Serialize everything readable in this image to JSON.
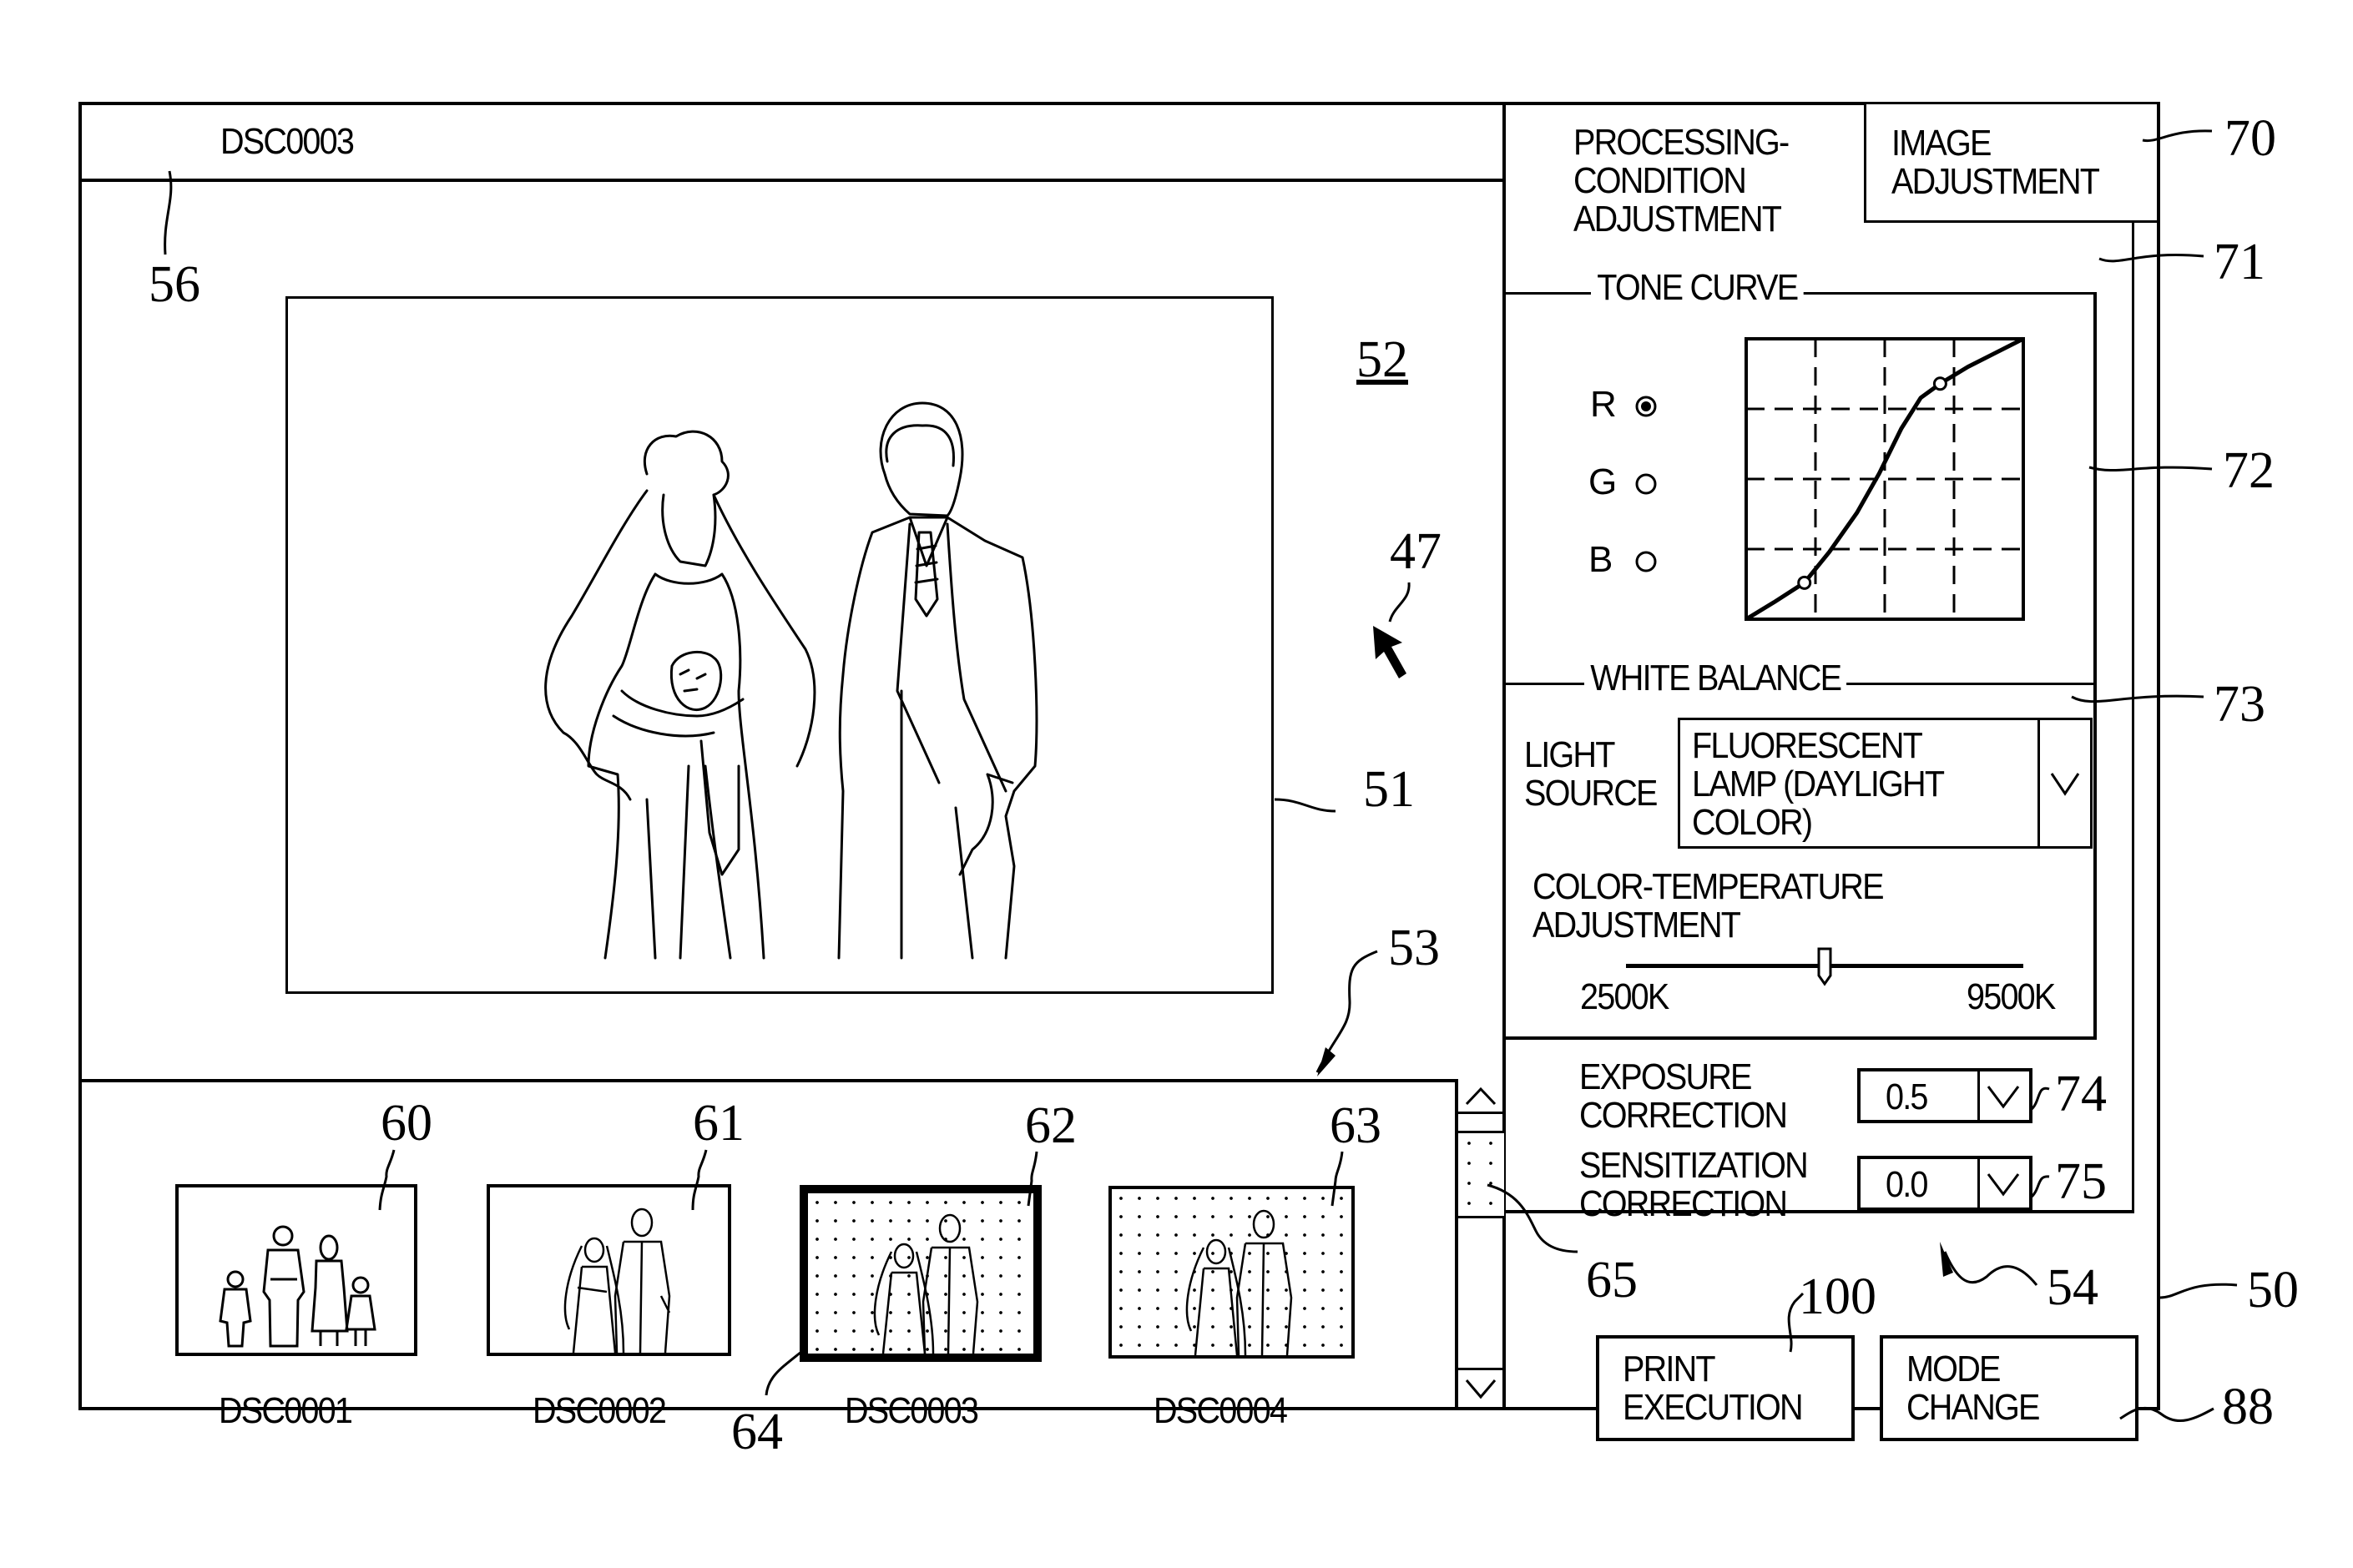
{
  "window": {
    "title": "DSC0003"
  },
  "preview": {
    "image_name": "DSC0003",
    "image_description": "bride and groom line drawing"
  },
  "thumbnails": [
    {
      "label": "DSC0001",
      "ref": "60",
      "scene": "family of four",
      "selected": false,
      "processed": false
    },
    {
      "label": "DSC0002",
      "ref": "61",
      "scene": "bride and groom",
      "selected": false,
      "processed": false
    },
    {
      "label": "DSC0003",
      "ref": "62",
      "scene": "bride and groom",
      "selected": true,
      "processed": true
    },
    {
      "label": "DSC0004",
      "ref": "63",
      "scene": "bride and groom",
      "selected": false,
      "processed": true
    }
  ],
  "scrollbar": {
    "up_icon": "chevron-up",
    "down_icon": "chevron-down",
    "thumb_position_fraction": 0.1,
    "thumb_size_fraction": 0.28
  },
  "panel": {
    "tab_processing": "PROCESSING-\nCONDITION\nADJUSTMENT",
    "tab_image": "IMAGE\nADJUSTMENT",
    "tone_curve": {
      "title": "TONE CURVE",
      "channels": [
        {
          "label": "R",
          "selected": true
        },
        {
          "label": "G",
          "selected": false
        },
        {
          "label": "B",
          "selected": false
        }
      ]
    },
    "white_balance": {
      "title": "WHITE BALANCE",
      "light_source_label": "LIGHT\nSOURCE",
      "light_source_value": "FLUORESCENT\nLAMP (DAYLIGHT\nCOLOR)",
      "color_temp_label": "COLOR-TEMPERATURE\nADJUSTMENT",
      "slider_min": "2500K",
      "slider_max": "9500K",
      "slider_fraction": 0.5
    },
    "exposure": {
      "label": "EXPOSURE\nCORRECTION",
      "value": "0.5"
    },
    "sensitization": {
      "label": "SENSITIZATION\nCORRECTION",
      "value": "0.0"
    }
  },
  "buttons": {
    "print": "PRINT\nEXECUTION",
    "mode": "MODE\nCHANGE"
  },
  "reference_numerals": {
    "r47": "47",
    "r50": "50",
    "r51": "51",
    "r52": "52",
    "r53": "53",
    "r54": "54",
    "r56": "56",
    "r60": "60",
    "r61": "61",
    "r62": "62",
    "r63": "63",
    "r64": "64",
    "r65": "65",
    "r70": "70",
    "r71": "71",
    "r72": "72",
    "r73": "73",
    "r74": "74",
    "r75": "75",
    "r88": "88",
    "r100": "100"
  },
  "chart_data": {
    "type": "line",
    "title": "TONE CURVE",
    "xlabel": "",
    "ylabel": "",
    "xlim": [
      0,
      1
    ],
    "ylim": [
      0,
      1
    ],
    "grid": true,
    "grid_divisions": 4,
    "series": [
      {
        "name": "R",
        "x": [
          0,
          0.1,
          0.21,
          0.3,
          0.4,
          0.48,
          0.56,
          0.63,
          0.7,
          0.8,
          0.9,
          1.0
        ],
        "y": [
          0,
          0.06,
          0.13,
          0.24,
          0.38,
          0.52,
          0.68,
          0.79,
          0.84,
          0.9,
          0.95,
          1.0
        ]
      }
    ],
    "control_points": [
      [
        0.21,
        0.13
      ],
      [
        0.7,
        0.84
      ]
    ]
  }
}
